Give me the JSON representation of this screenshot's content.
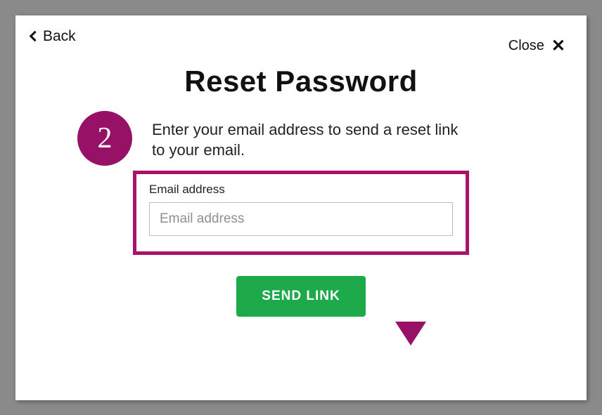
{
  "nav": {
    "back_label": "Back",
    "close_label": "Close"
  },
  "title": "Reset Password",
  "instructions": "Enter your email address to send a reset link to your email.",
  "email": {
    "label": "Email address",
    "placeholder": "Email address",
    "value": ""
  },
  "submit_label": "SEND LINK",
  "annotation": {
    "step_number": "2"
  }
}
